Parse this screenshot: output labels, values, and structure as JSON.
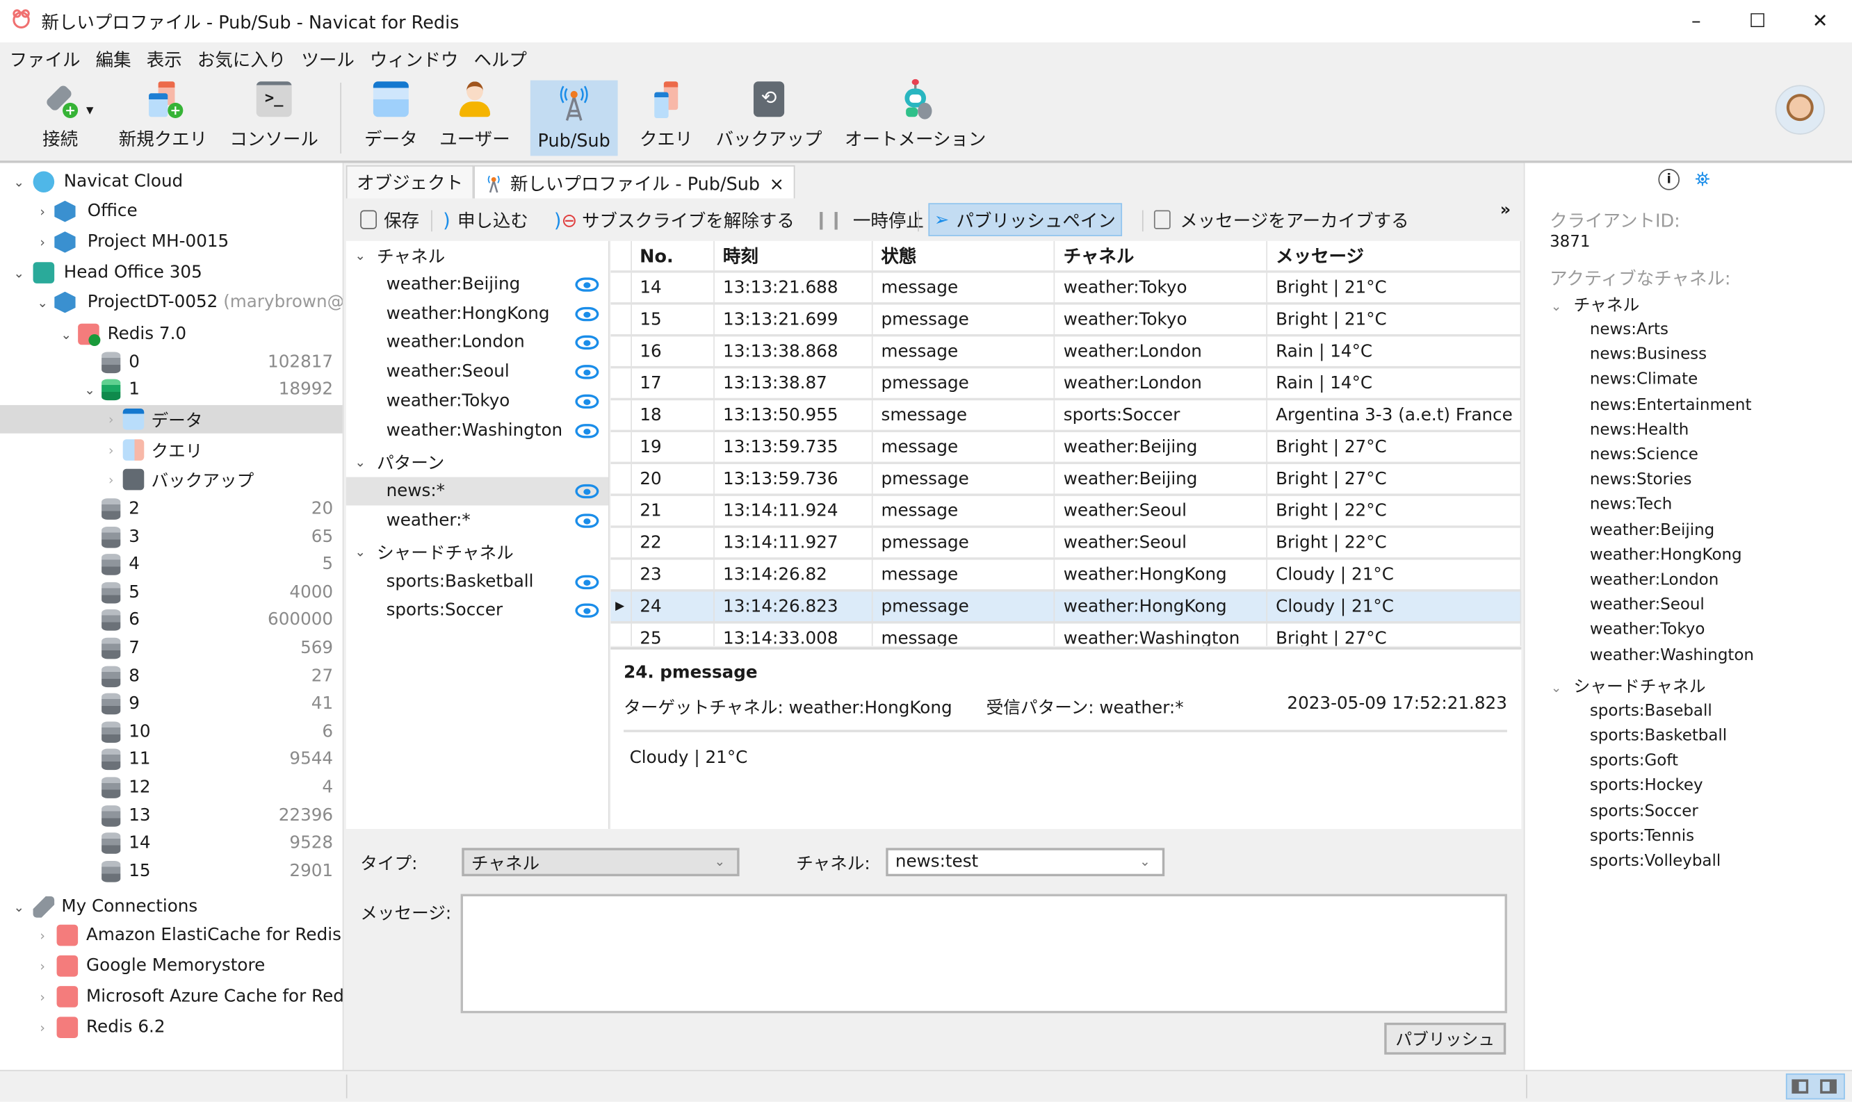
{
  "window": {
    "title": "新しいプロファイル - Pub/Sub - Navicat for Redis",
    "controls": {
      "minimize": "–",
      "maximize": "☐",
      "close": "✕"
    }
  },
  "menu": [
    "ファイル",
    "編集",
    "表示",
    "お気に入り",
    "ツール",
    "ウィンドウ",
    "ヘルプ"
  ],
  "toolbar": {
    "items": [
      {
        "label": "接続",
        "icon": "plug-add-icon"
      },
      {
        "label": "新規クエリ",
        "icon": "new-query-icon"
      },
      {
        "label": "コンソール",
        "icon": "console-icon"
      },
      {
        "label": "データ",
        "icon": "data-grid-icon"
      },
      {
        "label": "ユーザー",
        "icon": "user-icon"
      },
      {
        "label": "Pub/Sub",
        "icon": "broadcast-tower-icon",
        "active": true
      },
      {
        "label": "クエリ",
        "icon": "query-icon"
      },
      {
        "label": "バックアップ",
        "icon": "backup-icon"
      },
      {
        "label": "オートメーション",
        "icon": "robot-icon"
      }
    ]
  },
  "tree": {
    "navicat_cloud": "Navicat Cloud",
    "office": "Office",
    "project_mh": "Project MH-0015",
    "head_office": "Head Office 305",
    "project_dt": "ProjectDT-0052",
    "project_dt_user": "(marybrown@g",
    "redis70": "Redis 7.0",
    "databases": [
      {
        "name": "0",
        "count": "102817"
      },
      {
        "name": "1",
        "count": "18992"
      },
      {
        "name": "2",
        "count": "20"
      },
      {
        "name": "3",
        "count": "65"
      },
      {
        "name": "4",
        "count": "5"
      },
      {
        "name": "5",
        "count": "4000"
      },
      {
        "name": "6",
        "count": "600000"
      },
      {
        "name": "7",
        "count": "569"
      },
      {
        "name": "8",
        "count": "27"
      },
      {
        "name": "9",
        "count": "41"
      },
      {
        "name": "10",
        "count": "6"
      },
      {
        "name": "11",
        "count": "9544"
      },
      {
        "name": "12",
        "count": "4"
      },
      {
        "name": "13",
        "count": "22396"
      },
      {
        "name": "14",
        "count": "9528"
      },
      {
        "name": "15",
        "count": "2901"
      }
    ],
    "db1_children": [
      "データ",
      "クエリ",
      "バックアップ"
    ],
    "my_connections": "My Connections",
    "connections": [
      "Amazon ElastiCache for Redis",
      "Google Memorystore",
      "Microsoft Azure Cache for Redis",
      "Redis 6.2"
    ]
  },
  "tabs": {
    "objects": "オブジェクト",
    "active": "新しいプロファイル - Pub/Sub",
    "close": "×"
  },
  "subtoolbar": {
    "save": "保存",
    "subscribe": "申し込む",
    "unsubscribe": "サブスクライブを解除する",
    "pause": "一時停止",
    "publish_pane": "パブリッシュペイン",
    "archive": "メッセージをアーカイブする",
    "overflow": "»"
  },
  "channels": {
    "channel_header": "チャネル",
    "channel_items": [
      "weather:Beijing",
      "weather:HongKong",
      "weather:London",
      "weather:Seoul",
      "weather:Tokyo",
      "weather:Washington"
    ],
    "pattern_header": "パターン",
    "pattern_items": [
      "news:*",
      "weather:*"
    ],
    "shard_header": "シャードチャネル",
    "shard_items": [
      "sports:Basketball",
      "sports:Soccer"
    ]
  },
  "table": {
    "columns": [
      "No.",
      "時刻",
      "状態",
      "チャネル",
      "メッセージ"
    ],
    "rows": [
      {
        "no": "14",
        "time": "13:13:21.688",
        "state": "message",
        "channel": "weather:Tokyo",
        "msg": "Bright | 21°C"
      },
      {
        "no": "15",
        "time": "13:13:21.699",
        "state": "pmessage",
        "channel": "weather:Tokyo",
        "msg": "Bright | 21°C"
      },
      {
        "no": "16",
        "time": "13:13:38.868",
        "state": "message",
        "channel": "weather:London",
        "msg": "Rain | 14°C"
      },
      {
        "no": "17",
        "time": "13:13:38.87",
        "state": "pmessage",
        "channel": "weather:London",
        "msg": "Rain | 14°C"
      },
      {
        "no": "18",
        "time": "13:13:50.955",
        "state": "smessage",
        "channel": "sports:Soccer",
        "msg": "Argentina 3-3 (a.e.t) France"
      },
      {
        "no": "19",
        "time": "13:13:59.735",
        "state": "message",
        "channel": "weather:Beijing",
        "msg": "Bright | 27°C"
      },
      {
        "no": "20",
        "time": "13:13:59.736",
        "state": "pmessage",
        "channel": "weather:Beijing",
        "msg": "Bright | 27°C"
      },
      {
        "no": "21",
        "time": "13:14:11.924",
        "state": "message",
        "channel": "weather:Seoul",
        "msg": "Bright | 22°C"
      },
      {
        "no": "22",
        "time": "13:14:11.927",
        "state": "pmessage",
        "channel": "weather:Seoul",
        "msg": "Bright | 22°C"
      },
      {
        "no": "23",
        "time": "13:14:26.82",
        "state": "message",
        "channel": "weather:HongKong",
        "msg": "Cloudy | 21°C"
      },
      {
        "no": "24",
        "time": "13:14:26.823",
        "state": "pmessage",
        "channel": "weather:HongKong",
        "msg": "Cloudy | 21°C",
        "selected": true
      },
      {
        "no": "25",
        "time": "13:14:33.008",
        "state": "message",
        "channel": "weather:Washington",
        "msg": "Bright | 27°C"
      }
    ]
  },
  "detail": {
    "heading": "24. pmessage",
    "target_channel": "ターゲットチャネル: weather:HongKong",
    "pattern": "受信パターン: weather:*",
    "timestamp": "2023-05-09 17:52:21.823",
    "body": "Cloudy | 21°C"
  },
  "publish": {
    "type_label": "タイプ:",
    "type_value": "チャネル",
    "channel_label": "チャネル:",
    "channel_value": "news:test",
    "message_label": "メッセージ:",
    "message_value": "",
    "publish_button": "パブリッシュ"
  },
  "right": {
    "client_id_label": "クライアントID:",
    "client_id": "3871",
    "active_label": "アクティブなチャネル:",
    "channel_header": "チャネル",
    "channels": [
      "news:Arts",
      "news:Business",
      "news:Climate",
      "news:Entertainment",
      "news:Health",
      "news:Science",
      "news:Stories",
      "news:Tech",
      "weather:Beijing",
      "weather:HongKong",
      "weather:London",
      "weather:Seoul",
      "weather:Tokyo",
      "weather:Washington"
    ],
    "shard_header": "シャードチャネル",
    "shards": [
      "sports:Baseball",
      "sports:Basketball",
      "sports:Goft",
      "sports:Hockey",
      "sports:Soccer",
      "sports:Tennis",
      "sports:Volleyball"
    ]
  },
  "colors": {
    "accent": "#1a8de9",
    "selection": "#c3dcf2",
    "row_selected": "#dcebf9"
  }
}
